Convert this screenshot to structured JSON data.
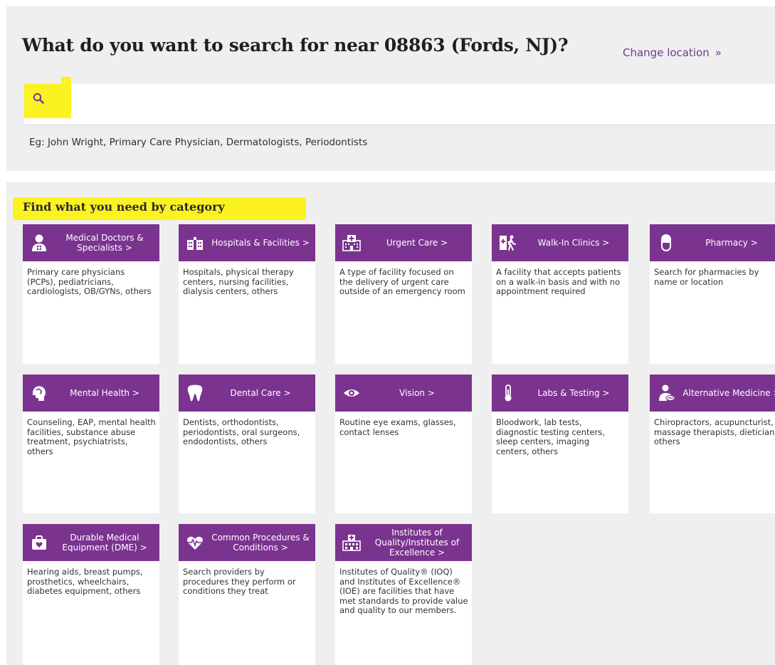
{
  "header": {
    "title": "What do you want to search for near 08863 (Fords, NJ)?",
    "change_location": "Change location",
    "change_location_arrow": "»"
  },
  "search": {
    "placeholder": "",
    "value": "",
    "hint": "Eg: John Wright, Primary Care Physician, Dermatologists, Periodontists"
  },
  "categories": {
    "heading": "Find what you need by category",
    "items": [
      {
        "title": "Medical Doctors & Specialists >",
        "description": "Primary care physicians (PCPs), pediatricians, cardiologists, OB/GYNs, others",
        "icon": "doctor-icon"
      },
      {
        "title": "Hospitals & Facilities >",
        "description": "Hospitals, physical therapy centers, nursing facilities, dialysis centers, others",
        "icon": "hospital-icon"
      },
      {
        "title": "Urgent Care >",
        "description": "A type of facility focused on the delivery of urgent care outside of an emergency room",
        "icon": "urgent-care-icon"
      },
      {
        "title": "Walk-In Clinics >",
        "description": "A facility that accepts patients on a walk-in basis and with no appointment required",
        "icon": "walk-in-icon"
      },
      {
        "title": "Pharmacy >",
        "description": "Search for pharmacies by name or location",
        "icon": "pill-icon"
      },
      {
        "title": "Mental Health >",
        "description": "Counseling, EAP, mental health facilities, substance abuse treatment, psychiatrists, others",
        "icon": "head-icon"
      },
      {
        "title": "Dental Care >",
        "description": "Dentists, orthodontists, periodontists, oral surgeons, endodontists, others",
        "icon": "tooth-icon"
      },
      {
        "title": "Vision >",
        "description": "Routine eye exams, glasses, contact lenses",
        "icon": "eye-icon"
      },
      {
        "title": "Labs & Testing >",
        "description": "Bloodwork, lab tests, diagnostic testing centers, sleep centers, imaging centers, others",
        "icon": "thermometer-icon"
      },
      {
        "title": "Alternative Medicine >",
        "description": "Chiropractors, acupuncturist, massage therapists, dieticians, others",
        "icon": "alt-medicine-icon"
      },
      {
        "title": "Durable Medical Equipment (DME) >",
        "description": "Hearing aids, breast pumps, prosthetics, wheelchairs, diabetes equipment, others",
        "icon": "medical-bag-icon"
      },
      {
        "title": "Common Procedures & Conditions >",
        "description": "Search providers by procedures they perform or conditions they treat",
        "icon": "heartbeat-icon"
      },
      {
        "title": "Institutes of Quality/Institutes of Excellence >",
        "description": "Institutes of Quality® (IOQ) and Institutes of Excellence® (IOE) are facilities that have met standards to provide value and quality to our members.",
        "icon": "institute-icon"
      }
    ]
  },
  "colors": {
    "accent": "#7b3390",
    "highlight": "#fbf221",
    "panel_bg": "#efefef",
    "link": "#6e3b8f"
  }
}
